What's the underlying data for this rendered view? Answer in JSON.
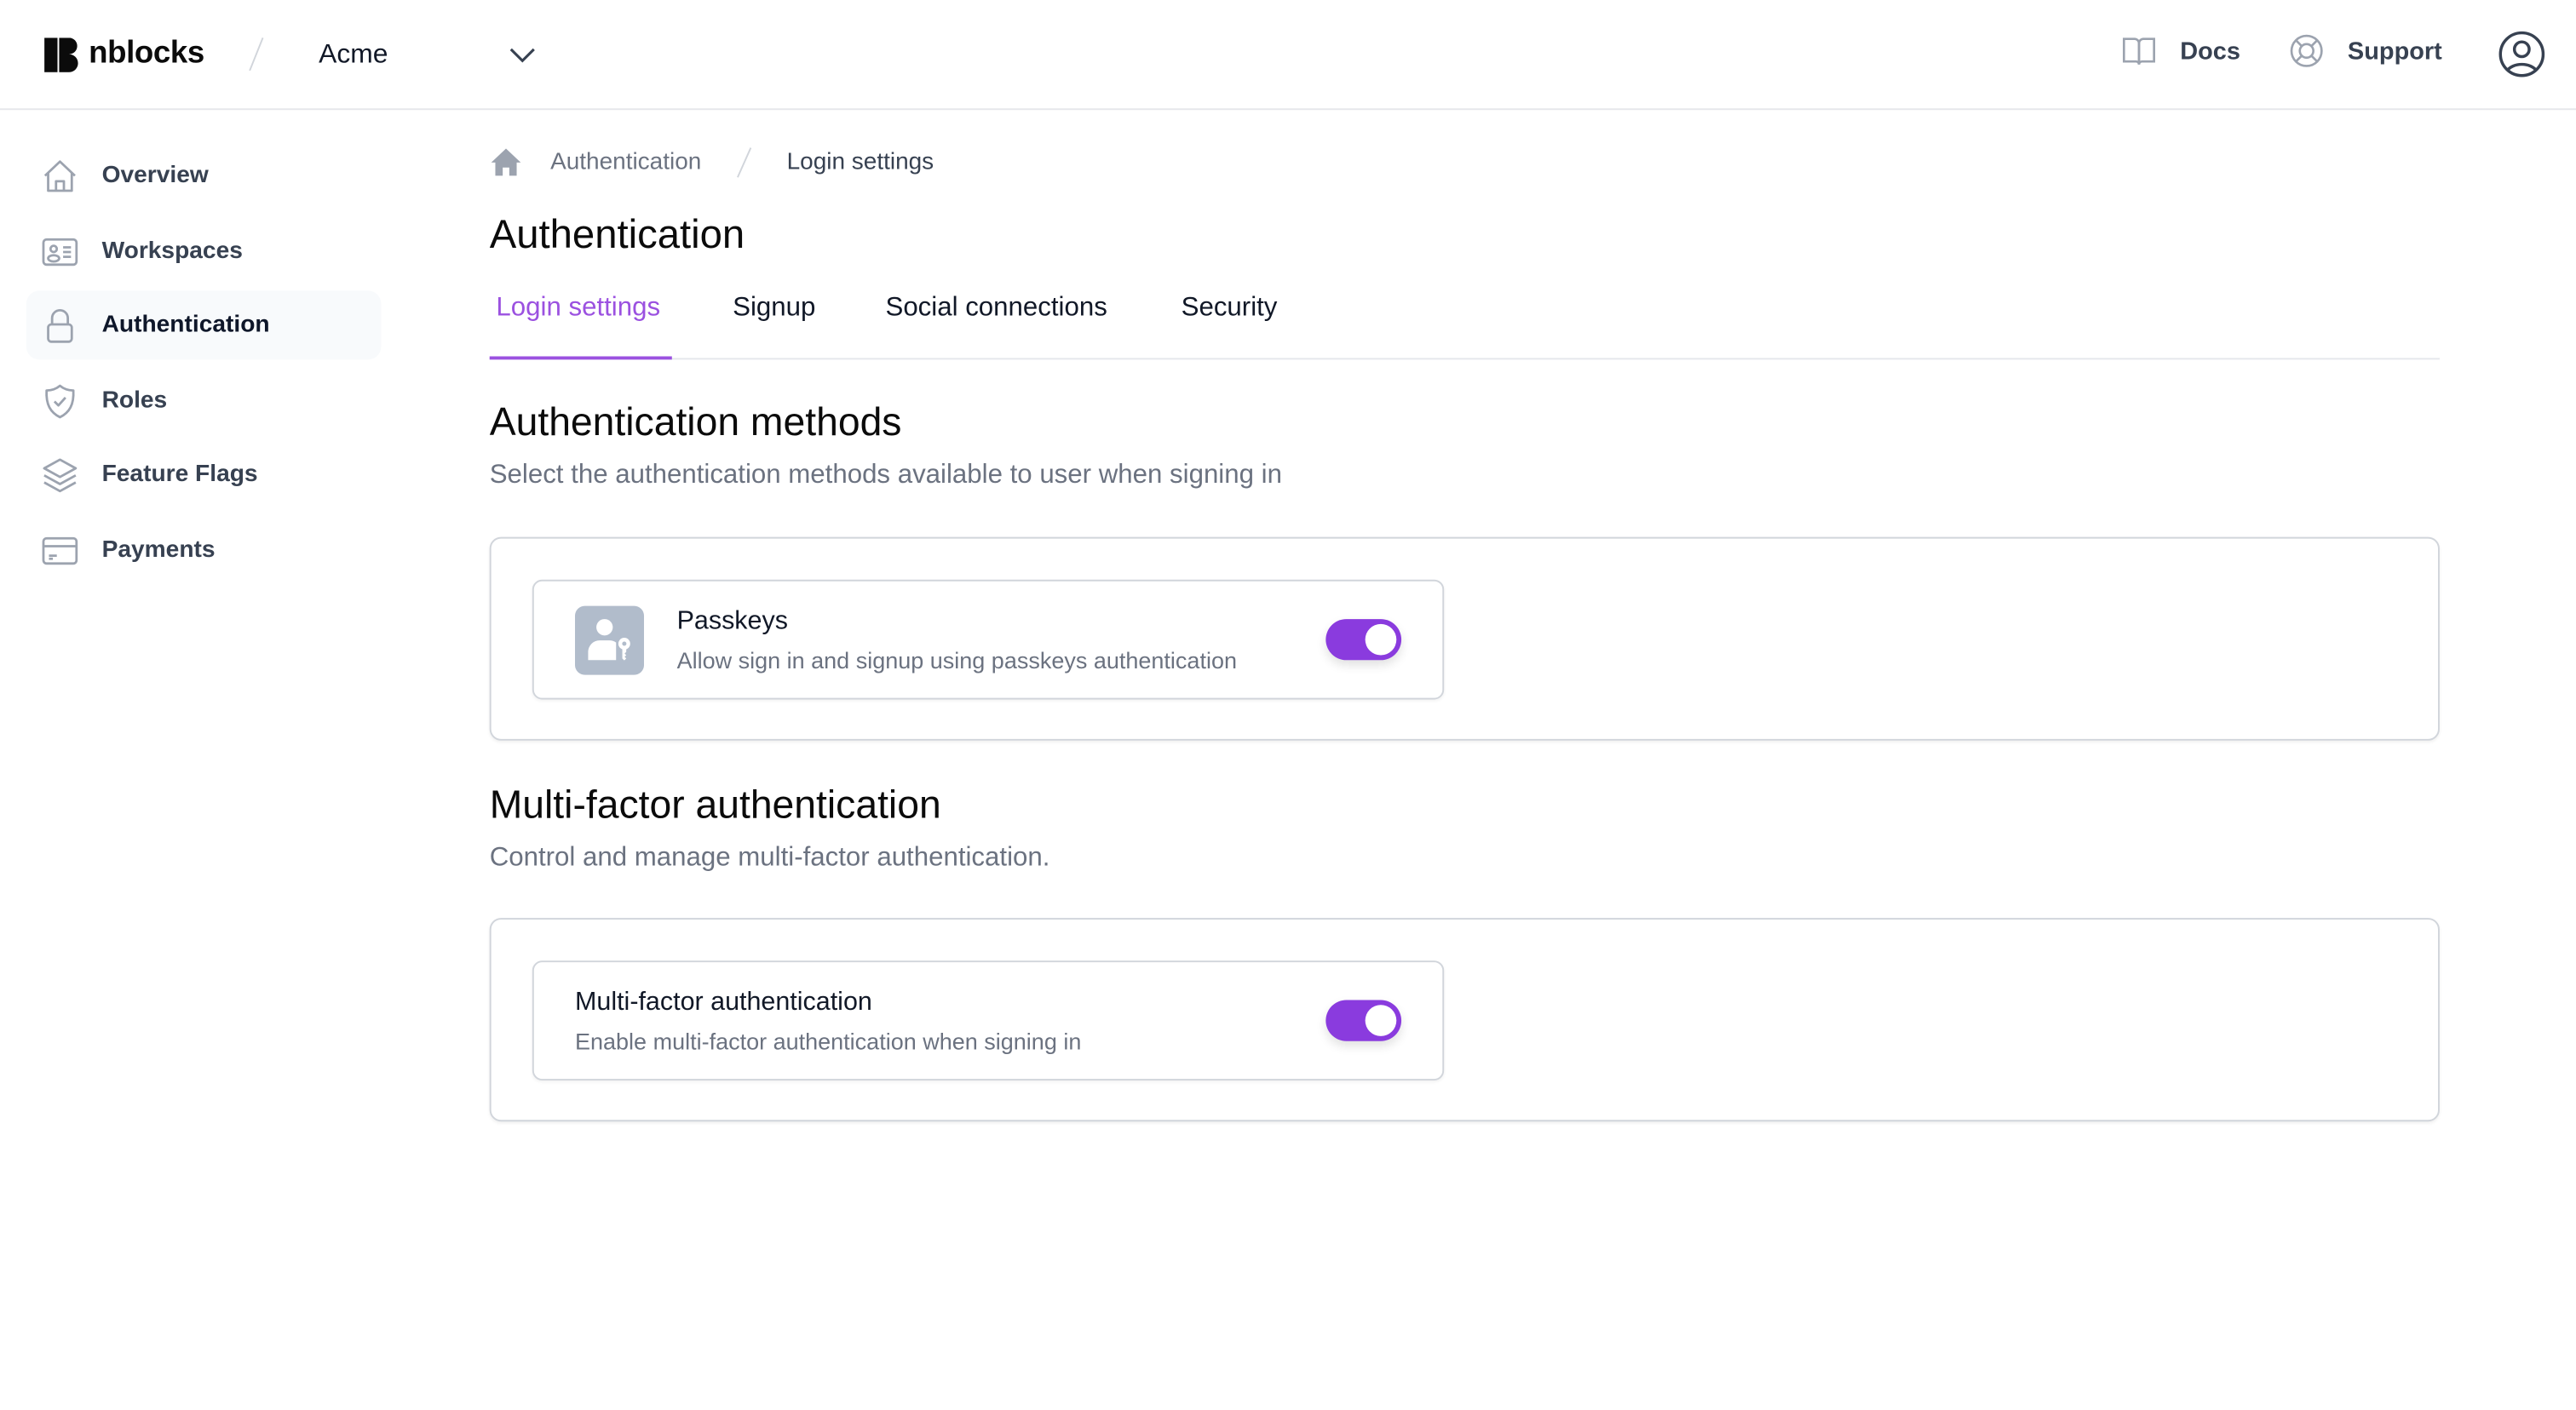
{
  "header": {
    "brand": "nblocks",
    "org_selector": {
      "selected": "Acme"
    },
    "links": [
      {
        "label": "Docs",
        "icon": "book-open-icon"
      },
      {
        "label": "Support",
        "icon": "lifebuoy-icon"
      }
    ],
    "account_icon": "user-circle-icon"
  },
  "sidebar": {
    "items": [
      {
        "label": "Overview",
        "icon": "home-icon",
        "active": false
      },
      {
        "label": "Workspaces",
        "icon": "id-card-icon",
        "active": false
      },
      {
        "label": "Authentication",
        "icon": "lock-icon",
        "active": true
      },
      {
        "label": "Roles",
        "icon": "shield-check-icon",
        "active": false
      },
      {
        "label": "Feature Flags",
        "icon": "layers-icon",
        "active": false
      },
      {
        "label": "Payments",
        "icon": "credit-card-icon",
        "active": false
      }
    ]
  },
  "breadcrumb": {
    "home_icon": "home-solid-icon",
    "items": [
      "Authentication",
      "Login settings"
    ]
  },
  "page": {
    "title": "Authentication",
    "tabs": [
      {
        "label": "Login settings",
        "active": true
      },
      {
        "label": "Signup",
        "active": false
      },
      {
        "label": "Social connections",
        "active": false
      },
      {
        "label": "Security",
        "active": false
      }
    ]
  },
  "sections": {
    "auth_methods": {
      "title": "Authentication methods",
      "subtitle": "Select the authentication methods available to user when signing in",
      "options": [
        {
          "title": "Passkeys",
          "description": "Allow sign in and signup using passkeys authentication",
          "icon": "user-key-icon",
          "enabled": true
        }
      ]
    },
    "mfa": {
      "title": "Multi-factor authentication",
      "subtitle": "Control and manage multi-factor authentication.",
      "options": [
        {
          "title": "Multi-factor authentication",
          "description": "Enable multi-factor authentication when signing in",
          "enabled": true
        }
      ]
    }
  },
  "colors": {
    "accent": "#9b51e0",
    "toggle_on": "#8a3bde",
    "text_primary": "#111827",
    "text_muted": "#6b7280",
    "border": "#d1d5db"
  }
}
